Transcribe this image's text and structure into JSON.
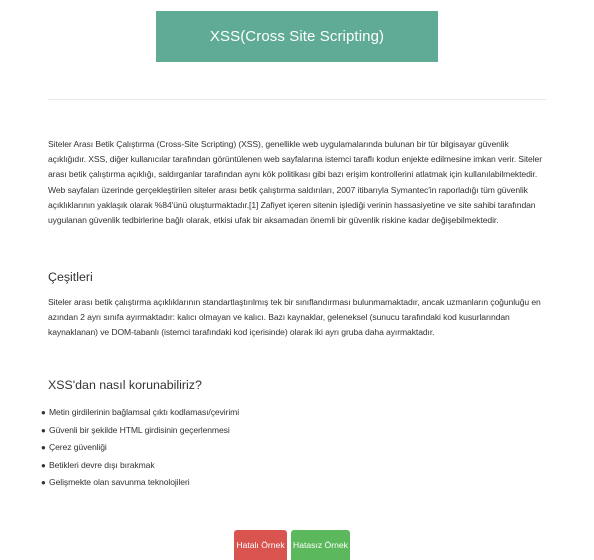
{
  "header": {
    "title": "XSS(Cross Site Scripting)"
  },
  "intro": {
    "text": "Siteler Arası Betik Çalıştırma (Cross-Site Scripting) (XSS), genellikle web uygulamalarında bulunan bir tür bilgisayar güvenlik açıklığıdır. XSS, diğer kullanıcılar tarafından görüntülenen web sayfalarına istemci taraflı kodun enjekte edilmesine imkan verir. Siteler arası betik çalıştırma açıklığı, saldırganlar tarafından aynı kök politikası gibi bazı erişim kontrollerini atlatmak için kullanılabilmektedir. Web sayfaları üzerinde gerçekleştirilen siteler arası betik çalıştırma saldırıları, 2007 itibarıyla Symantec'in raporladığı tüm güvenlik açıklıklarının yaklaşık olarak %84'ünü oluşturmaktadır.[1] Zafiyet içeren sitenin işlediği verinin hassasiyetine ve site sahibi tarafından uygulanan güvenlik tedbirlerine bağlı olarak, etkisi ufak bir aksamadan önemli bir güvenlik riskine kadar değişebilmektedir."
  },
  "types": {
    "heading": "Çeşitleri",
    "text": "Siteler arası betik çalıştırma açıklıklarının standartlaştırılmış tek bir sınıflandırması bulunmamaktadır, ancak uzmanların çoğunluğu en azından 2 ayrı sınıfa ayırmaktadır: kalıcı olmayan ve kalıcı. Bazı kaynaklar, geleneksel (sunucu tarafındaki kod kusurlarından kaynaklanan) ve DOM-tabanlı (istemci tarafındaki kod içerisinde) olarak iki ayrı gruba daha ayırmaktadır."
  },
  "protection": {
    "heading": "XSS'dan nasıl korunabiliriz?",
    "items": [
      "Metin girdilerinin bağlamsal çıktı kodlaması/çevirimi",
      "Güvenli bir şekilde HTML girdisinin geçerlenmesi",
      "Çerez güvenliği",
      "Betikleri devre dışı bırakmak",
      "Gelişmekte olan savunma teknolojileri"
    ],
    "bullet_glyph": "●"
  },
  "buttons": {
    "bad_label": "Hatalı Örnek",
    "good_label": "Hatasız Örnek"
  },
  "colors": {
    "banner": "#5fab96",
    "bad_button": "#d9534f",
    "good_button": "#5cb85c"
  }
}
